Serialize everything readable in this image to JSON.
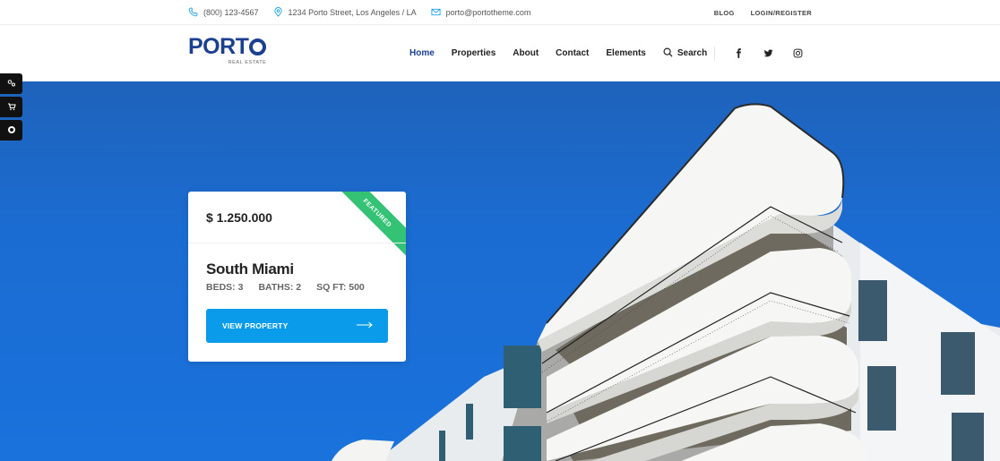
{
  "topbar": {
    "phone": "(800) 123-4567",
    "address": "1234 Porto Street, Los Angeles / LA",
    "email": "porto@portotheme.com",
    "links": [
      "BLOG",
      "LOGIN/REGISTER"
    ]
  },
  "logo": {
    "main_left": "PORT",
    "sub": "REAL ESTATE"
  },
  "nav": {
    "items": [
      "Home",
      "Properties",
      "About",
      "Contact",
      "Elements"
    ],
    "active": "Home",
    "search_label": "Search"
  },
  "social": [
    "facebook-icon",
    "twitter-icon",
    "instagram-icon"
  ],
  "side_tools": [
    "settings-icon",
    "cart-icon",
    "target-icon"
  ],
  "card": {
    "price": "$ 1.250.000",
    "ribbon": "FEATURED",
    "title": "South Miami",
    "specs": [
      "BEDS: 3",
      "BATHS: 2",
      "SQ FT: 500"
    ],
    "button_label": "VIEW PROPERTY"
  },
  "colors": {
    "brand": "#1b3f91",
    "accent": "#0a9cea",
    "ribbon": "#34c274",
    "sky": "#1a72dc"
  }
}
